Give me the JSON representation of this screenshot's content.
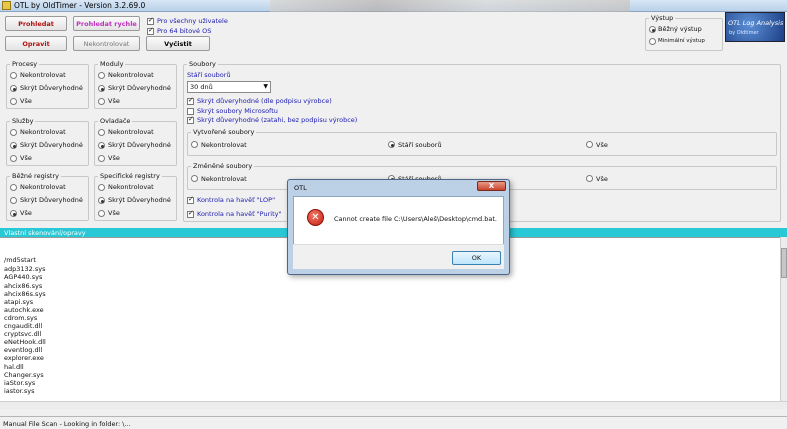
{
  "window": {
    "title": "OTL by OldTimer - Version 3.2.69.0",
    "app_icon": "app-icon"
  },
  "toolbar": {
    "scan_button": "Prohledat",
    "quick_scan_button": "Prohledat rychle",
    "fix_button": "Opravit",
    "no_check_button": "Nekontrolovat",
    "clean_button": "Vyčistit",
    "all_users_check": {
      "label": "Pro všechny uživatele",
      "checked": true
    },
    "x64_check": {
      "label": "Pro 64 bitové OS",
      "checked": true
    }
  },
  "output": {
    "title": "Výstup",
    "options": [
      {
        "label": "Běžný výstup",
        "selected": true
      },
      {
        "label": "Minimální výstup",
        "selected": false
      }
    ]
  },
  "logo": {
    "line1": "OTL Log Analysis",
    "line2": "by Oldtimer"
  },
  "groups": {
    "processes": {
      "title": "Procesy",
      "options": [
        "Nekontrolovat",
        "Skrýt Důveryhodné",
        "Vše"
      ],
      "selected": 1
    },
    "modules": {
      "title": "Moduly",
      "options": [
        "Nekontrolovat",
        "Skrýt Důveryhodné",
        "Vše"
      ],
      "selected": 1
    },
    "services": {
      "title": "Služby",
      "options": [
        "Nekontrolovat",
        "Skrýt Důveryhodné",
        "Vše"
      ],
      "selected": 1
    },
    "drivers": {
      "title": "Ovladače",
      "options": [
        "Nekontrolovat",
        "Skrýt Důveryhodné",
        "Vše"
      ],
      "selected": 1
    },
    "std_registry": {
      "title": "Běžné registry",
      "options": [
        "Nekontrolovat",
        "Skrýt Důveryhodné",
        "Vše"
      ],
      "selected": 2
    },
    "ext_registry": {
      "title": "Specifické registry",
      "options": [
        "Nekontrolovat",
        "Skrýt Důveryhodné",
        "Vše"
      ],
      "selected": 1
    }
  },
  "files": {
    "title": "Soubory",
    "age_label": "Stáří souborů",
    "age_value": "30 dnů",
    "checks": [
      {
        "label": "Skrýt důveryhodné (dle podpisu výrobce)",
        "checked": true
      },
      {
        "label": "Skrýt soubory Microsoftu",
        "checked": false
      },
      {
        "label": "Skrýt důveryhodné (zatahi, bez podpisu výrobce)",
        "checked": true
      }
    ],
    "created": {
      "title": "Vytvořené soubory",
      "options": [
        "Nekontrolovat",
        "Stáří souborů",
        "Vše"
      ],
      "selected": 1
    },
    "modified": {
      "title": "Změněné soubory",
      "options": [
        "Nekontrolovat",
        "Stáří souborů",
        "Vše"
      ],
      "selected": 1
    },
    "lop_check": {
      "label": "Kontrola na havěť \"LOP\"",
      "checked": true
    },
    "purity_check": {
      "label": "Kontrola na havěť \"Purity\"",
      "checked": true
    }
  },
  "custom_scan": {
    "title": "Vlastní skenování/opravy",
    "lines": [
      "/md5start",
      "adp3132.sys",
      "AGP440.sys",
      "ahcix86.sys",
      "ahcix86s.sys",
      "atapi.sys",
      "autochk.exe",
      "cdrom.sys",
      "cngaudit.dll",
      "cryptsvc.dll",
      "eNetHook.dll",
      "eventlog.dll",
      "explorer.exe",
      "hal.dll",
      "Changer.sys",
      "iaStor.sys",
      "iastor.sys"
    ]
  },
  "status": {
    "text": "Manual File Scan - Looking in folder: \\..."
  },
  "dialog": {
    "title": "OTL",
    "close_label": "X",
    "message": "Cannot create file C:\\Users\\Aleš\\Desktop\\cmd.bat.",
    "ok_label": "OK",
    "icon": "error-icon"
  }
}
